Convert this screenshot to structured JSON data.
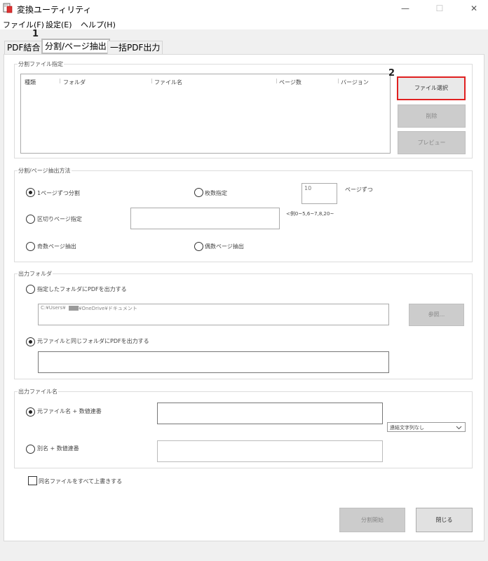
{
  "window": {
    "title": "変換ユーティリティ",
    "controls": {
      "minimize": "—",
      "maximize": "☐",
      "close": "✕"
    }
  },
  "menu": [
    "ファイル(F)",
    "設定(E)",
    "ヘルプ(H)"
  ],
  "tabs": [
    {
      "label": "PDF結合",
      "active": false
    },
    {
      "label": "分割/ページ抽出",
      "active": true
    },
    {
      "label": "一括PDF出力",
      "active": false
    }
  ],
  "callouts": {
    "one": "1",
    "two": "2"
  },
  "split_files": {
    "legend": "分割ファイル指定",
    "columns": [
      "種類",
      "フォルダ",
      "ファイル名",
      "ページ数",
      "バージョン"
    ],
    "buttons": {
      "select": "ファイル選択",
      "delete": "削除",
      "preview": "プレビュー"
    }
  },
  "method": {
    "legend": "分割/ページ抽出方法",
    "per_page": "1ページずつ分割",
    "count": "枚数指定",
    "count_value": "10",
    "count_suffix": "ページずつ",
    "range": "区切りページ指定",
    "range_hint": "<例0~5,6~7,8,20~",
    "odd": "奇数ページ抽出",
    "even": "偶数ページ抽出"
  },
  "output_folder": {
    "legend": "出力フォルダ",
    "specified": "指定したフォルダにPDFを出力する",
    "path_prefix": "C:¥Users¥",
    "path_suffix": "¥OneDrive¥ドキュメント",
    "browse": "参照...",
    "same": "元ファイルと同じフォルダにPDFを出力する"
  },
  "output_name": {
    "legend": "出力ファイル名",
    "original_serial": "元ファイル名 + 数値連番",
    "separator": "連結文字列なし",
    "alias_serial": "別名 + 数値連番"
  },
  "overwrite": "同名ファイルをすべて上書きする",
  "footer": {
    "start": "分割開始",
    "close": "閉じる"
  },
  "colors": {
    "highlight": "#e02020",
    "disabled": "#cccccc"
  }
}
